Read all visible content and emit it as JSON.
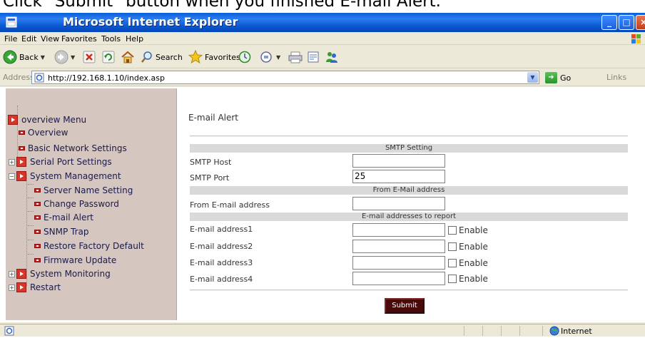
{
  "caption": "Click \"Submit\" button when you finished E-mail Alert.",
  "window": {
    "title": "Microsoft Internet Explorer"
  },
  "menu": [
    "File",
    "Edit",
    "View",
    "Favorites",
    "Tools",
    "Help"
  ],
  "toolbar": {
    "back_label": "Back",
    "search_label": "Search",
    "favorites_label": "Favorites"
  },
  "address": {
    "label": "Address",
    "value": "http://192.168.1.10/index.asp",
    "go_label": "Go",
    "links_label": "Links"
  },
  "nav": {
    "root": "overview Menu",
    "items": [
      "Overview",
      "Basic Network Settings",
      "Serial Port Settings",
      "System Management",
      "Server Name Setting",
      "Change Password",
      "E-mail Alert",
      "SNMP Trap",
      "Restore Factory Default",
      "Firmware Update",
      "System Monitoring",
      "Restart"
    ]
  },
  "page": {
    "title": "E-mail Alert",
    "smtp_section": "SMTP Setting",
    "smtp_host_label": "SMTP Host",
    "smtp_host_value": "",
    "smtp_port_label": "SMTP Port",
    "smtp_port_value": "25",
    "from_section": "From E-Mail address",
    "from_label": "From E-mail address",
    "from_value": "",
    "report_section": "E-mail addresses to report",
    "addresses": [
      {
        "label": "E-mail address1",
        "value": "",
        "enable_label": "Enable",
        "enabled": false
      },
      {
        "label": "E-mail address2",
        "value": "",
        "enable_label": "Enable",
        "enabled": false
      },
      {
        "label": "E-mail address3",
        "value": "",
        "enable_label": "Enable",
        "enabled": false
      },
      {
        "label": "E-mail address4",
        "value": "",
        "enable_label": "Enable",
        "enabled": false
      }
    ],
    "submit_label": "Submit"
  },
  "status": {
    "zone": "Internet"
  },
  "colors": {
    "titlebar": "#0a5fd8",
    "nav_bg": "#d6c6c0",
    "section_bg": "#d9d9d9",
    "submit_bg": "#4a0a0a"
  }
}
